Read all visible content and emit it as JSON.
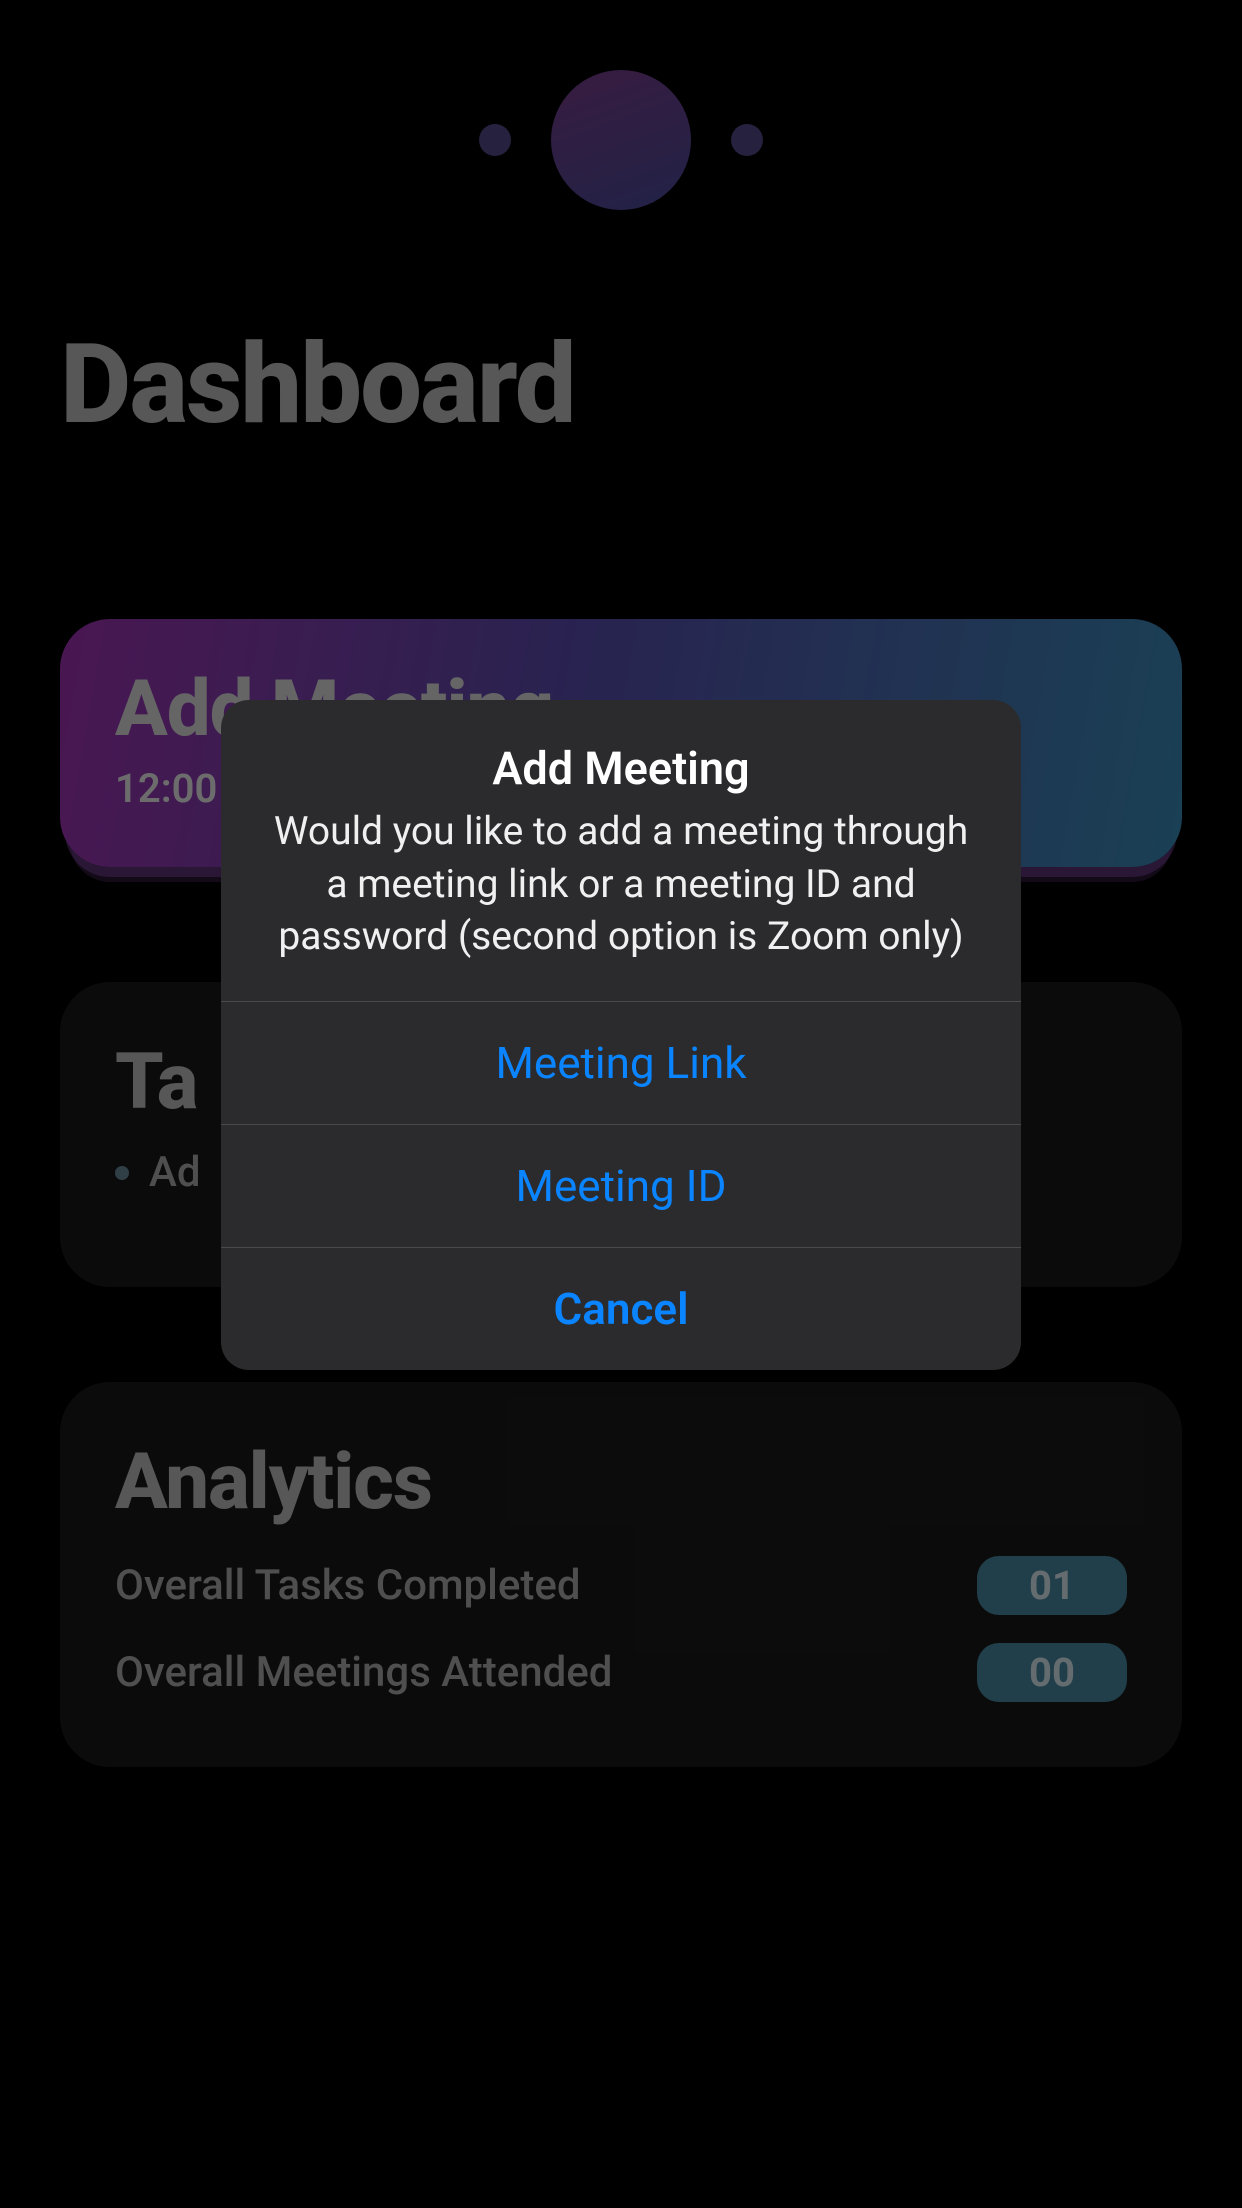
{
  "page": {
    "title": "Dashboard"
  },
  "addMeeting": {
    "title": "Add Meeting",
    "time": "12:00"
  },
  "tasks": {
    "title": "Ta",
    "items": [
      {
        "text": "Ad"
      }
    ]
  },
  "analytics": {
    "title": "Analytics",
    "rows": [
      {
        "label": "Overall Tasks Completed",
        "value": "01"
      },
      {
        "label": "Overall Meetings Attended",
        "value": "00"
      }
    ]
  },
  "alert": {
    "title": "Add Meeting",
    "message": "Would you like to add a meeting through a meeting link or a meeting ID and password (second option is Zoom only)",
    "options": [
      {
        "label": "Meeting Link"
      },
      {
        "label": "Meeting ID"
      }
    ],
    "cancel": "Cancel"
  }
}
